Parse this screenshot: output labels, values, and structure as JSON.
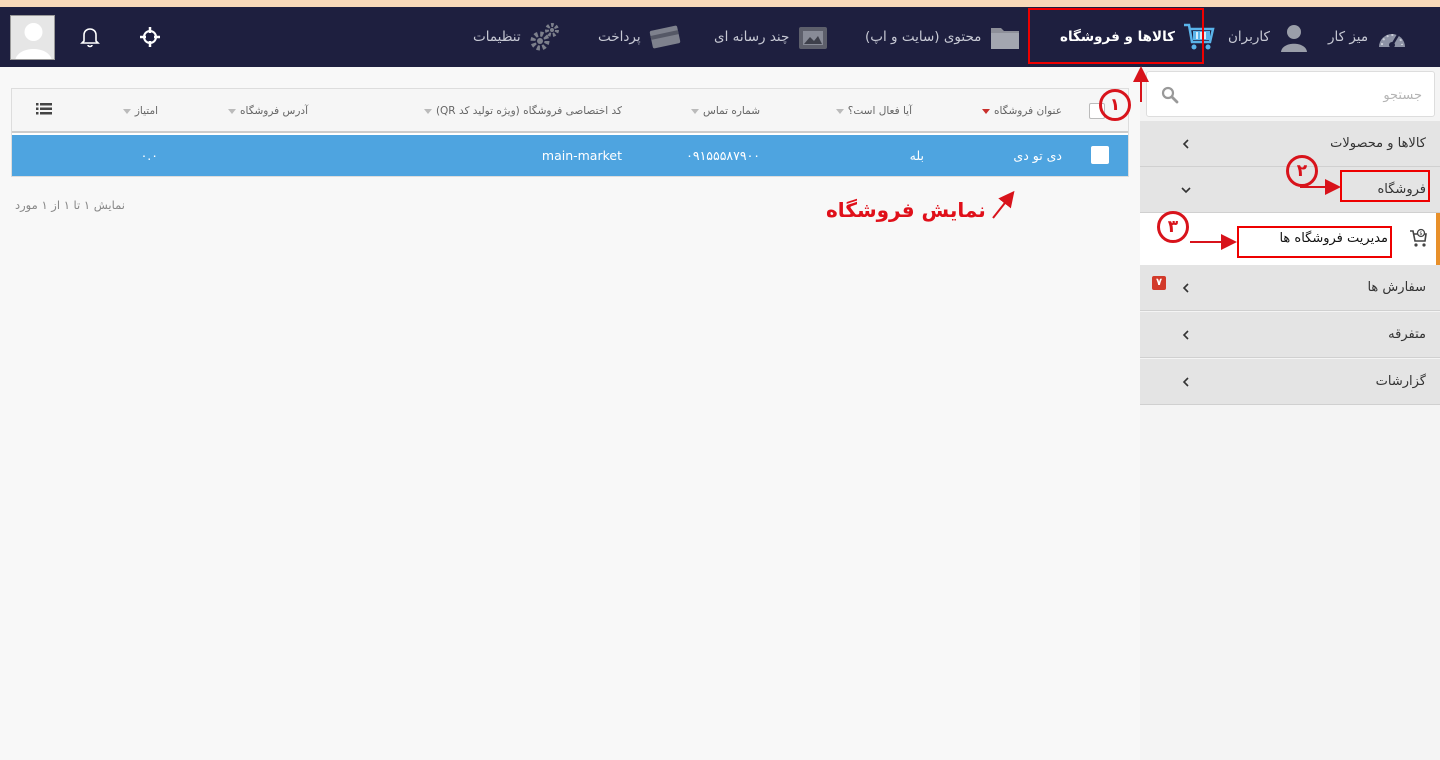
{
  "header": {
    "nav": [
      {
        "label": "میز کار",
        "icon": "speedometer-icon"
      },
      {
        "label": "کاربران",
        "icon": "user-icon"
      },
      {
        "label": "کالاها و فروشگاه",
        "icon": "shopping-cart-icon",
        "active": true
      },
      {
        "label": "محتوی (سایت و اپ)",
        "icon": "folder-icon"
      },
      {
        "label": "چند رسانه ای",
        "icon": "media-icon"
      },
      {
        "label": "پرداخت",
        "icon": "credit-card-icon"
      },
      {
        "label": "تنظیمات",
        "icon": "gear-icon"
      }
    ],
    "icons": [
      "crosshair-icon",
      "bell-icon"
    ]
  },
  "sidebar": {
    "search_placeholder": "جستجو",
    "items": [
      {
        "label": "کالاها و محصولات"
      },
      {
        "label": "فروشگاه",
        "expanded": true
      },
      {
        "label": "سفارش ها",
        "badge": "۷"
      },
      {
        "label": "متفرقه"
      },
      {
        "label": "گزارشات"
      }
    ],
    "submenu": {
      "label": "مدیریت فروشگاه ها",
      "icon": "store-icon"
    }
  },
  "table": {
    "columns": [
      "عنوان فروشگاه",
      "آیا فعال است؟",
      "شماره تماس",
      "کد اختصاصی فروشگاه (ویژه تولید کد QR)",
      "آدرس فروشگاه",
      "امتیاز"
    ],
    "rows": [
      {
        "title": "دی تو دی",
        "active": "بله",
        "phone": "۰۹۱۵۵۵۸۷۹۰۰",
        "code": "main-market",
        "address": "",
        "score": "۰.۰"
      }
    ],
    "pager": "نمایش ۱ تا ۱ از ۱ مورد"
  },
  "annotations": {
    "num1": "۱",
    "num2": "۲",
    "num3": "۳",
    "label": "نمایش فروشگاه",
    "color": "#e0101a"
  },
  "colors": {
    "topbar": "#1e1f3f",
    "row_selected": "#4ea4e0",
    "submenu_accent": "#e8902a"
  }
}
